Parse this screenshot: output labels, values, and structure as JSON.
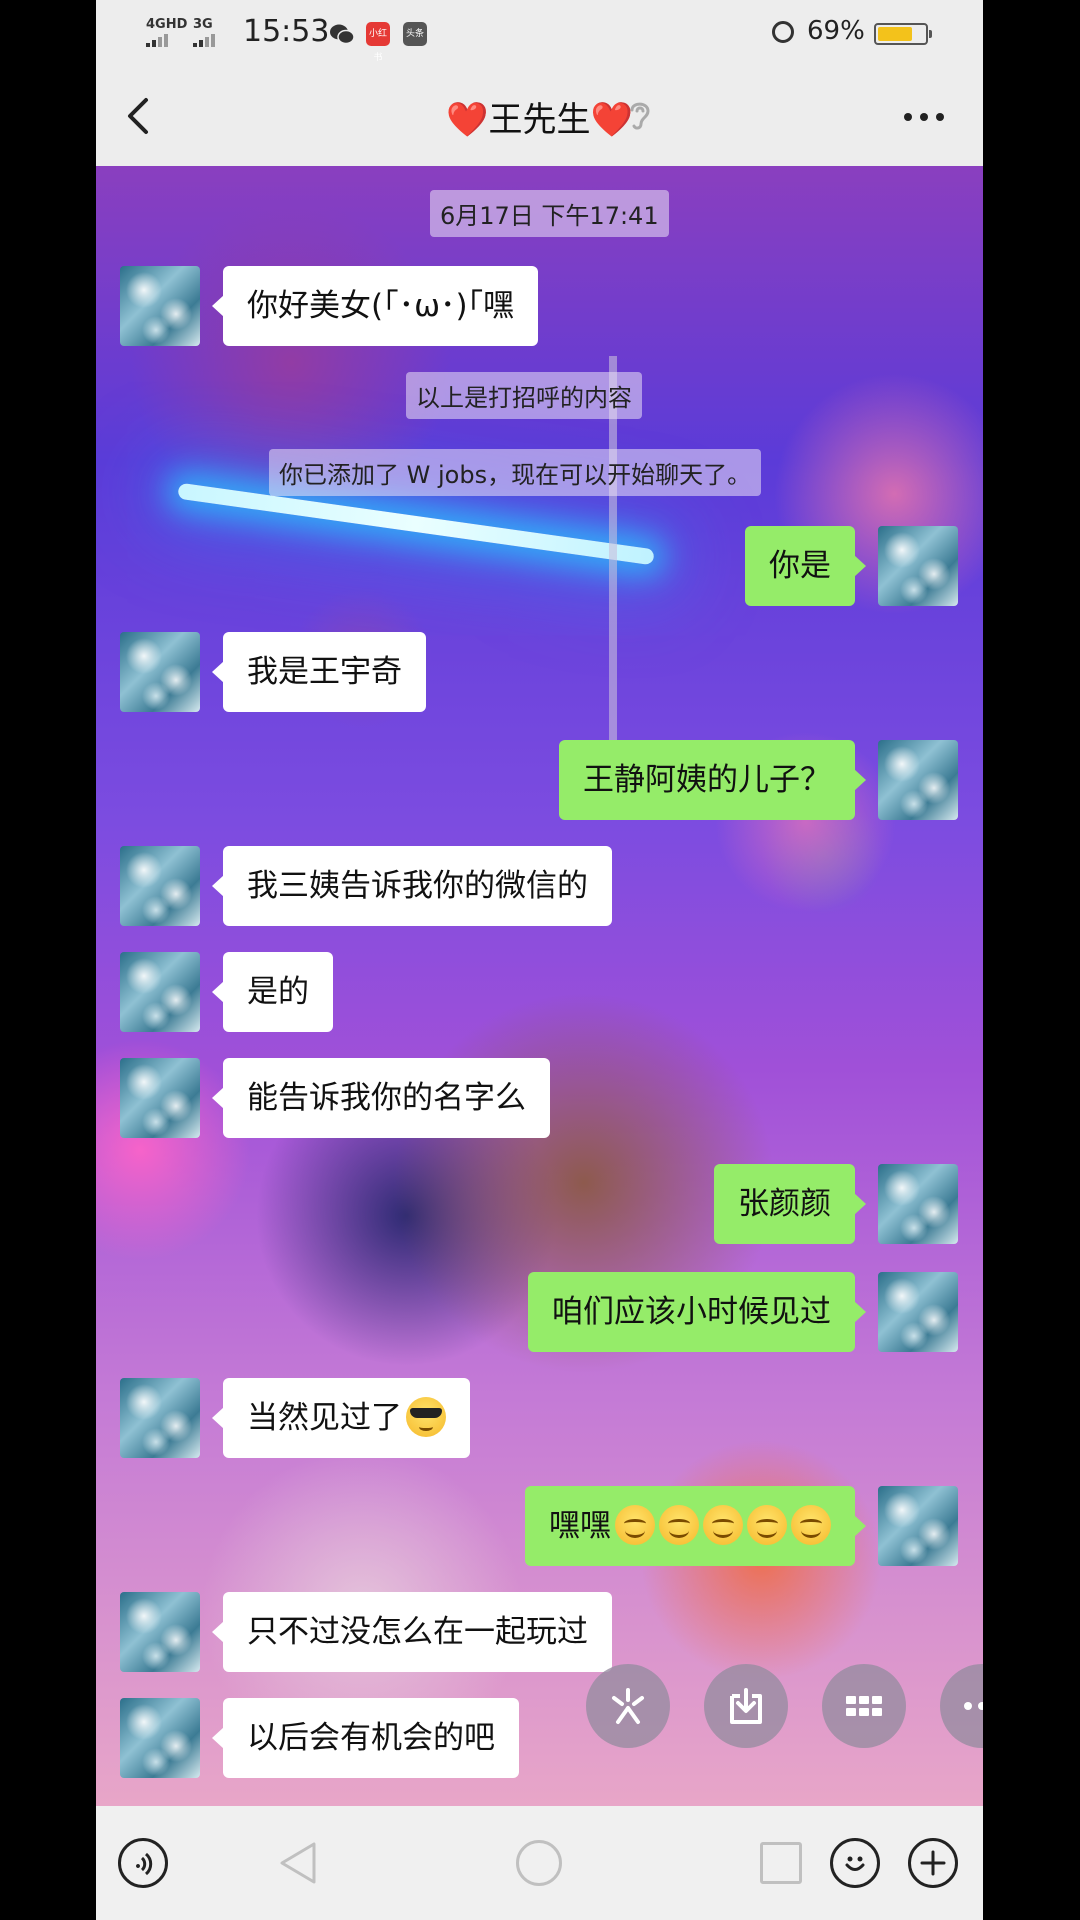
{
  "status_bar": {
    "network_1": "4GHD",
    "network_2": "3G",
    "time": "15:53",
    "app_badge_1": "小红书",
    "app_badge_2": "头条",
    "battery_percent": "69%"
  },
  "header": {
    "title": "❤️王先生❤️"
  },
  "chat": {
    "timestamp": "6月17日 下午17:41",
    "greeting_note": "以上是打招呼的内容",
    "added_notice": "你已添加了 W jobs，现在可以开始聊天了。",
    "messages": [
      {
        "side": "in",
        "text": "你好美女(｢･ω･)｢嘿"
      },
      {
        "side": "out",
        "text": "你是"
      },
      {
        "side": "in",
        "text": "我是王宇奇"
      },
      {
        "side": "out",
        "text": "王静阿姨的儿子？"
      },
      {
        "side": "in",
        "text": "我三姨告诉我你的微信的"
      },
      {
        "side": "in",
        "text": "是的"
      },
      {
        "side": "in",
        "text": "能告诉我你的名字么"
      },
      {
        "side": "out",
        "text": "张颜颜"
      },
      {
        "side": "out",
        "text": "咱们应该小时候见过"
      },
      {
        "side": "in",
        "text": "当然见过了",
        "emoji": "sunglasses-emoji"
      },
      {
        "side": "out",
        "text": "嘿嘿",
        "emoji": "smiling-emoji x5"
      },
      {
        "side": "in",
        "text": "只不过没怎么在一起玩过"
      },
      {
        "side": "in",
        "text": "以后会有机会的吧"
      }
    ]
  },
  "colors": {
    "incoming_bubble": "#ffffff",
    "outgoing_bubble": "#95ec69",
    "header_bg": "#ededed"
  },
  "icons": {
    "back": "chevron-left-icon",
    "ear": "ear-icon",
    "more": "more-dots-icon",
    "voice": "voice-icon",
    "emoji": "emoji-icon",
    "add": "plus-icon",
    "fab_1": "sparkle-icon",
    "fab_2": "download-icon",
    "fab_3": "grid-icon",
    "fab_4": "more-dots-icon"
  }
}
